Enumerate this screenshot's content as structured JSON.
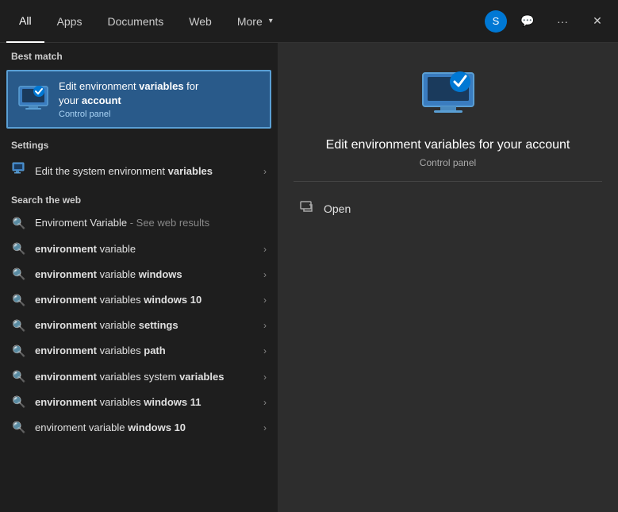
{
  "nav": {
    "tabs": [
      {
        "id": "all",
        "label": "All",
        "active": true
      },
      {
        "id": "apps",
        "label": "Apps",
        "active": false
      },
      {
        "id": "documents",
        "label": "Documents",
        "active": false
      },
      {
        "id": "web",
        "label": "Web",
        "active": false
      },
      {
        "id": "more",
        "label": "More",
        "active": false
      }
    ],
    "user_initial": "S"
  },
  "left": {
    "best_match_label": "Best match",
    "best_match_title_normal": "Edit environment variables for your ",
    "best_match_title_bold": "account",
    "best_match_subtitle": "Control panel",
    "settings_label": "Settings",
    "settings_item_text_normal": "Edit the system environment ",
    "settings_item_text_bold": "variables",
    "web_label": "Search the web",
    "web_items": [
      {
        "text_normal": "Enviroment Variable",
        "text_see": " - See web results",
        "text_bold": "",
        "has_chevron": false
      },
      {
        "text_normal": "",
        "text_bold": "environment",
        "text_after": " variable",
        "has_chevron": true
      },
      {
        "text_normal": "",
        "text_bold": "environment",
        "text_after": " variable ",
        "text_bold2": "windows",
        "has_chevron": true
      },
      {
        "text_normal": "",
        "text_bold": "environment",
        "text_after": " variables ",
        "text_bold2": "windows 10",
        "has_chevron": true
      },
      {
        "text_normal": "",
        "text_bold": "environment",
        "text_after": " variable ",
        "text_bold2": "settings",
        "has_chevron": true
      },
      {
        "text_normal": "",
        "text_bold": "environment",
        "text_after": " variables ",
        "text_bold2": "path",
        "has_chevron": true
      },
      {
        "text_normal": "",
        "text_bold": "environment",
        "text_after": " variables system ",
        "text_bold2": "variables",
        "has_chevron": true
      },
      {
        "text_normal": "",
        "text_bold": "environment",
        "text_after": " variables ",
        "text_bold2": "windows 11",
        "has_chevron": true
      },
      {
        "text_normal": "enviroment variable ",
        "text_bold": "windows 10",
        "text_after": "",
        "has_chevron": true
      }
    ]
  },
  "right": {
    "app_title": "Edit environment variables for your account",
    "app_subtitle": "Control panel",
    "open_label": "Open"
  }
}
